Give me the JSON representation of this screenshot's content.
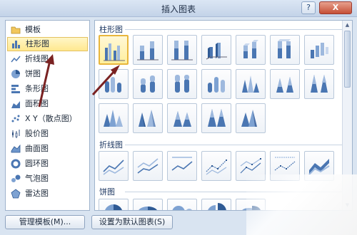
{
  "window": {
    "title": "插入图表",
    "help_label": "?",
    "close_label": "X"
  },
  "sidebar": {
    "items": [
      {
        "label": "模板",
        "icon": "folder-icon"
      },
      {
        "label": "柱形图",
        "icon": "column-chart-icon",
        "selected": true
      },
      {
        "label": "折线图",
        "icon": "line-chart-icon"
      },
      {
        "label": "饼图",
        "icon": "pie-chart-icon"
      },
      {
        "label": "条形图",
        "icon": "bar-chart-icon"
      },
      {
        "label": "面积图",
        "icon": "area-chart-icon"
      },
      {
        "label": "X Y（散点图）",
        "icon": "scatter-chart-icon"
      },
      {
        "label": "股价图",
        "icon": "stock-chart-icon"
      },
      {
        "label": "曲面图",
        "icon": "surface-chart-icon"
      },
      {
        "label": "圆环图",
        "icon": "doughnut-chart-icon"
      },
      {
        "label": "气泡图",
        "icon": "bubble-chart-icon"
      },
      {
        "label": "雷达图",
        "icon": "radar-chart-icon"
      }
    ]
  },
  "sections": {
    "column": {
      "title": "柱形图"
    },
    "line": {
      "title": "折线图"
    },
    "pie": {
      "title": "饼图"
    }
  },
  "footer": {
    "manage_templates_label": "管理模板(M)...",
    "set_default_label": "设置为默认图表(S)"
  },
  "colors": {
    "selection": "#ffe88f",
    "arrow": "#7a2222",
    "accent": "#4a76b2"
  }
}
